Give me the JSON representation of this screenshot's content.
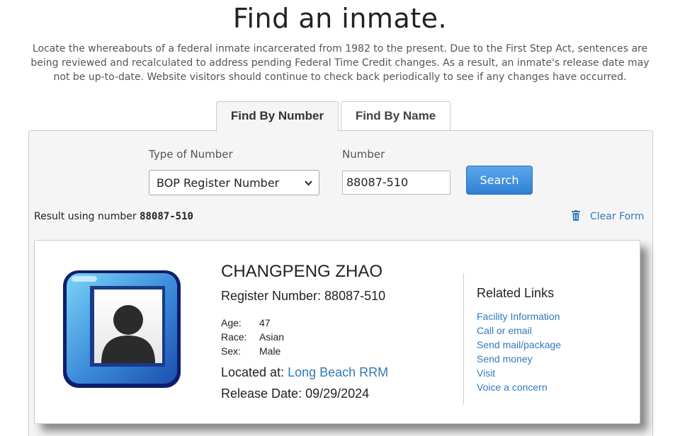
{
  "page": {
    "title": "Find an inmate.",
    "intro": "Locate the whereabouts of a federal inmate incarcerated from 1982 to the present. Due to the First Step Act, sentences are being reviewed and recalculated to address pending Federal Time Credit changes. As a result, an inmate's release date may not be up-to-date. Website visitors should continue to check back periodically to see if any changes have occurred."
  },
  "tabs": [
    {
      "label": "Find By Number",
      "active": true
    },
    {
      "label": "Find By Name",
      "active": false
    }
  ],
  "form": {
    "type_label": "Type of Number",
    "type_value": "BOP Register Number",
    "number_label": "Number",
    "number_value": "88087-510",
    "search_label": "Search",
    "result_prefix": "Result using number",
    "result_number": "88087-510",
    "clear_label": "Clear Form"
  },
  "inmate": {
    "name": "CHANGPENG ZHAO",
    "register": "Register Number: 88087-510",
    "age_label": "Age:",
    "age": "47",
    "race_label": "Race:",
    "race": "Asian",
    "sex_label": "Sex:",
    "sex": "Male",
    "located_label": "Located at:",
    "location": "Long Beach RRM",
    "release": "Release Date: 09/29/2024",
    "photo_icon": "person-placeholder-icon"
  },
  "related": {
    "title": "Related Links",
    "links": [
      "Facility Information",
      "Call or email",
      "Send mail/package",
      "Send money",
      "Visit",
      "Voice a concern"
    ]
  },
  "colors": {
    "link": "#337ab7",
    "search_button": "#2f80d6",
    "panel_bg": "#f5f5f5"
  }
}
